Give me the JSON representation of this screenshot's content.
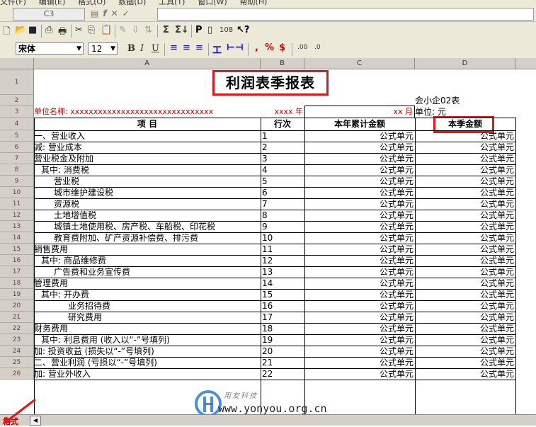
{
  "menubar": {
    "items": [
      "文件(F)",
      "编辑(E)",
      "格式(O)",
      "数据(D)",
      "工具(T)",
      "窗口(W)",
      "帮助(H)"
    ]
  },
  "formula_bar": {
    "cell_ref": "C3",
    "icons": [
      "book-icon",
      "function-icon",
      "cancel-icon",
      "confirm-icon"
    ],
    "value": ""
  },
  "toolbar1": {
    "buttons": [
      "new",
      "open",
      "save",
      "print-preview",
      "print",
      "cut",
      "copy",
      "paste",
      "format-painter",
      "fill",
      "sort",
      "sum",
      "sum-total",
      "P",
      "page",
      "108",
      "help"
    ],
    "labels": {
      "P": "P",
      "108": "108",
      "sum": "Σ"
    }
  },
  "toolbar2": {
    "font_name": "宋体",
    "font_size": "12",
    "bold": "B",
    "italic": "I",
    "underline": "U",
    "comma": ",",
    "percent": "%",
    "currency": "$",
    "dec_inc": ".00",
    "dec_dec": ".0"
  },
  "columns": [
    "A",
    "B",
    "C",
    "D"
  ],
  "sheet": {
    "title": "利润表季报表",
    "form_code": "会小企02表",
    "unit_label": "单位名称: xxxxxxxxxxxxxxxxxxxxxxxxxxxxxxx",
    "year": "xxxx 年",
    "month": "xx 月",
    "currency_unit": "单位: 元",
    "headers": {
      "item": "项      目",
      "row_no": "行次",
      "ytd": "本年累计金额",
      "quarter": "本季金额"
    },
    "formula_text": "公式单元",
    "rows": [
      {
        "n": "5",
        "item": "一、营业收入",
        "line": "1",
        "indent": 0
      },
      {
        "n": "6",
        "item": "减: 营业成本",
        "line": "2",
        "indent": 0
      },
      {
        "n": "7",
        "item": "营业税金及附加",
        "line": "3",
        "indent": 0
      },
      {
        "n": "8",
        "item": "其中: 消费税",
        "line": "4",
        "indent": 1
      },
      {
        "n": "9",
        "item": "营业税",
        "line": "5",
        "indent": 2
      },
      {
        "n": "10",
        "item": "城市维护建设税",
        "line": "6",
        "indent": 2
      },
      {
        "n": "11",
        "item": "资源税",
        "line": "7",
        "indent": 2
      },
      {
        "n": "12",
        "item": "土地增值税",
        "line": "8",
        "indent": 2
      },
      {
        "n": "13",
        "item": "城镇土地使用税、房产税、车船税、印花税",
        "line": "9",
        "indent": 2
      },
      {
        "n": "14",
        "item": "教育费附加、矿产资源补偿费、排污费",
        "line": "10",
        "indent": 2
      },
      {
        "n": "15",
        "item": "销售费用",
        "line": "11",
        "indent": 0
      },
      {
        "n": "16",
        "item": "其中: 商品维修费",
        "line": "12",
        "indent": 1
      },
      {
        "n": "17",
        "item": "广告费和业务宣传费",
        "line": "13",
        "indent": 2
      },
      {
        "n": "18",
        "item": "管理费用",
        "line": "14",
        "indent": 0
      },
      {
        "n": "19",
        "item": "其中: 开办费",
        "line": "15",
        "indent": 1
      },
      {
        "n": "20",
        "item": "业务招待费",
        "line": "16",
        "indent": 3
      },
      {
        "n": "21",
        "item": "研究费用",
        "line": "17",
        "indent": 3
      },
      {
        "n": "22",
        "item": "财务费用",
        "line": "18",
        "indent": 0
      },
      {
        "n": "23",
        "item": "其中: 利息费用 (收入以“-”号填列)",
        "line": "19",
        "indent": 1
      },
      {
        "n": "24",
        "item": "加: 投资收益 (损失以“-”号填列)",
        "line": "20",
        "indent": 0
      },
      {
        "n": "25",
        "item": "二、营业利润 (亏损以“-”号填列)",
        "line": "21",
        "indent": 0
      },
      {
        "n": "26",
        "item": "加: 营业外收入",
        "line": "22",
        "indent": 0
      }
    ]
  },
  "sheet_tab": {
    "label": "格式"
  },
  "watermark": {
    "brand": "用友科技",
    "url": "www.yonyou.org.cn"
  },
  "colors": {
    "accent_red": "#e0181b",
    "label_red": "#c00000",
    "chrome": "#ece9d8",
    "header_gray": "#d4d0c8"
  }
}
